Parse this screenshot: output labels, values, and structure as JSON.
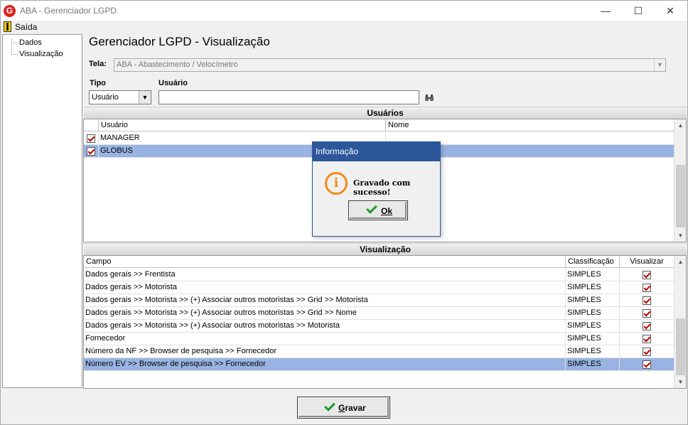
{
  "window": {
    "title": "ABA - Gerenciador LGPD",
    "logo_letter": "G"
  },
  "menu": {
    "exit_label": "Saída"
  },
  "tree": {
    "items": [
      {
        "label": "Dados"
      },
      {
        "label": "Visualização"
      }
    ]
  },
  "page": {
    "title": "Gerenciador LGPD - Visualização"
  },
  "filters": {
    "tela_label": "Tela:",
    "tela_value": "ABA - Abastecimento / Velocímetro",
    "tipo_label": "Tipo",
    "tipo_value": "Usuário",
    "usuario_label": "Usuário",
    "usuario_value": ""
  },
  "users_section": {
    "title": "Usuários",
    "columns": [
      "Usuário",
      "Nome"
    ],
    "rows": [
      {
        "checked": true,
        "usuario": "MANAGER",
        "nome": "",
        "selected": false
      },
      {
        "checked": true,
        "usuario": "GLOBUS",
        "nome": "",
        "selected": true
      }
    ]
  },
  "view_section": {
    "title": "Visualização",
    "columns": [
      "Campo",
      "Classificação",
      "Visualizar"
    ],
    "rows": [
      {
        "campo": "Dados gerais >> Frentista",
        "classificacao": "SIMPLES",
        "visualizar": true,
        "selected": false
      },
      {
        "campo": "Dados gerais >> Motorista",
        "classificacao": "SIMPLES",
        "visualizar": true,
        "selected": false
      },
      {
        "campo": "Dados gerais >> Motorista >> (+) Associar outros motoristas >> Grid >> Motorista",
        "classificacao": "SIMPLES",
        "visualizar": true,
        "selected": false
      },
      {
        "campo": "Dados gerais >> Motorista >> (+) Associar outros motoristas >> Grid >> Nome",
        "classificacao": "SIMPLES",
        "visualizar": true,
        "selected": false
      },
      {
        "campo": "Dados gerais >> Motorista >> (+) Associar outros motoristas >> Motorista",
        "classificacao": "SIMPLES",
        "visualizar": true,
        "selected": false
      },
      {
        "campo": "Fornecedor",
        "classificacao": "SIMPLES",
        "visualizar": true,
        "selected": false
      },
      {
        "campo": "Número da NF >> Browser de pesquisa >> Fornecedor",
        "classificacao": "SIMPLES",
        "visualizar": true,
        "selected": false
      },
      {
        "campo": "Número EV >> Browser de pesquisa >> Fornecedor",
        "classificacao": "SIMPLES",
        "visualizar": true,
        "selected": true
      }
    ]
  },
  "dialog": {
    "title": "Informação",
    "message": "Gravado com sucesso!",
    "ok_label": "Ok",
    "icon": "info-icon"
  },
  "footer": {
    "save_label": "Gravar"
  },
  "colors": {
    "selection": "#99b4e2",
    "dialog_title_bar": "#2b579a",
    "info_icon": "#f08c1a",
    "check_red": "#c00000",
    "check_green": "#1a9a2a"
  }
}
